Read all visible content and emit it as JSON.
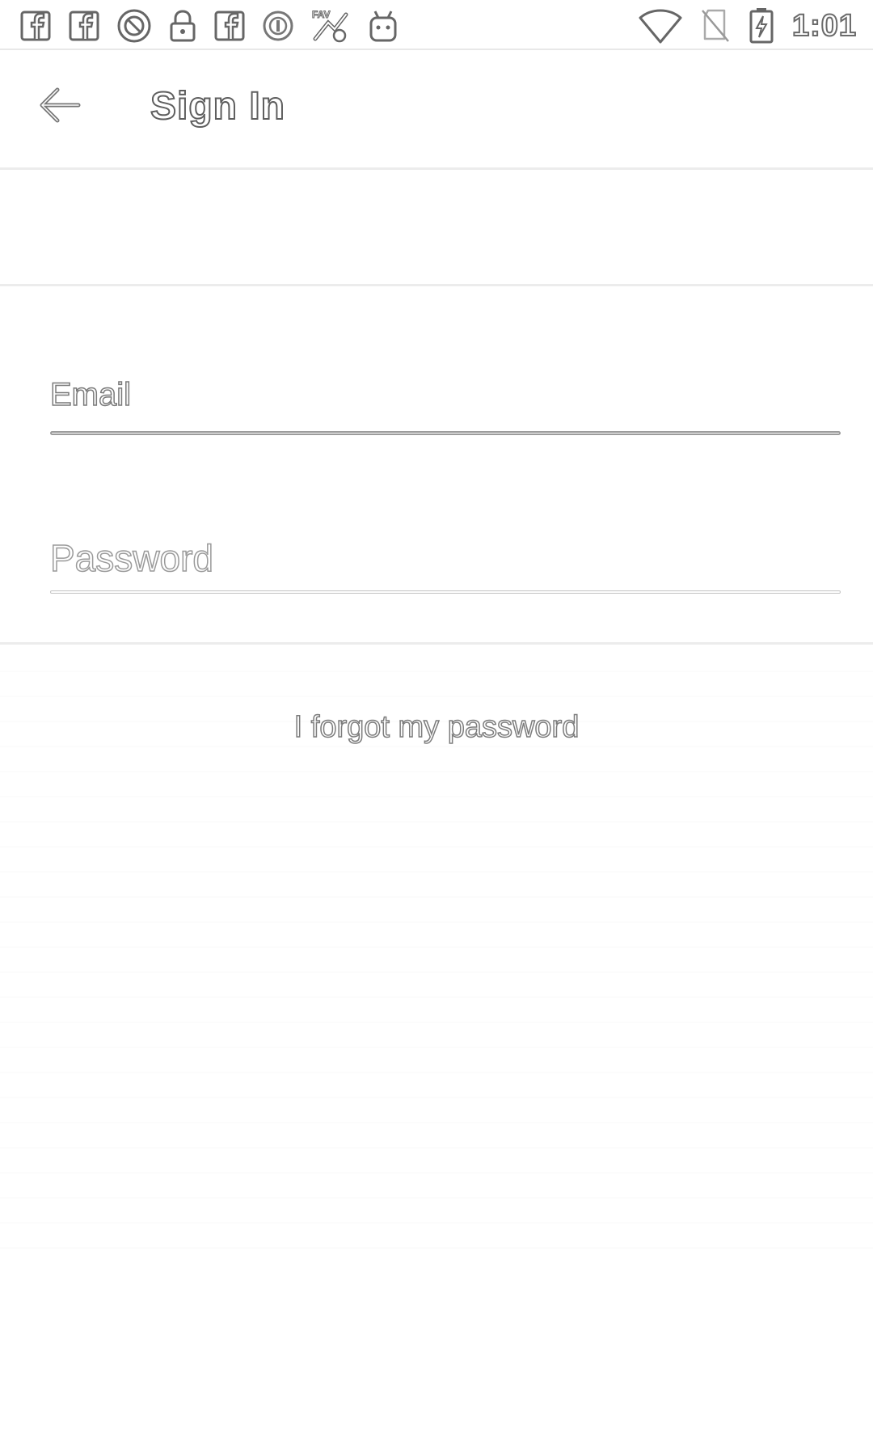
{
  "status_bar": {
    "time": "1:01",
    "left_icons": [
      "facebook-icon",
      "facebook-icon",
      "sync-icon",
      "lock-icon",
      "facebook-icon",
      "circle-icon",
      "game-icon",
      "android-icon"
    ],
    "right_icons": [
      "wifi-icon",
      "no-sim-icon",
      "battery-charging-icon"
    ]
  },
  "app_bar": {
    "title": "Sign In",
    "back_icon": "back-arrow-icon"
  },
  "form": {
    "email_placeholder": "Email",
    "email_value": "",
    "password_placeholder": "Password",
    "password_value": ""
  },
  "links": {
    "forgot_password": "I forgot my password"
  }
}
